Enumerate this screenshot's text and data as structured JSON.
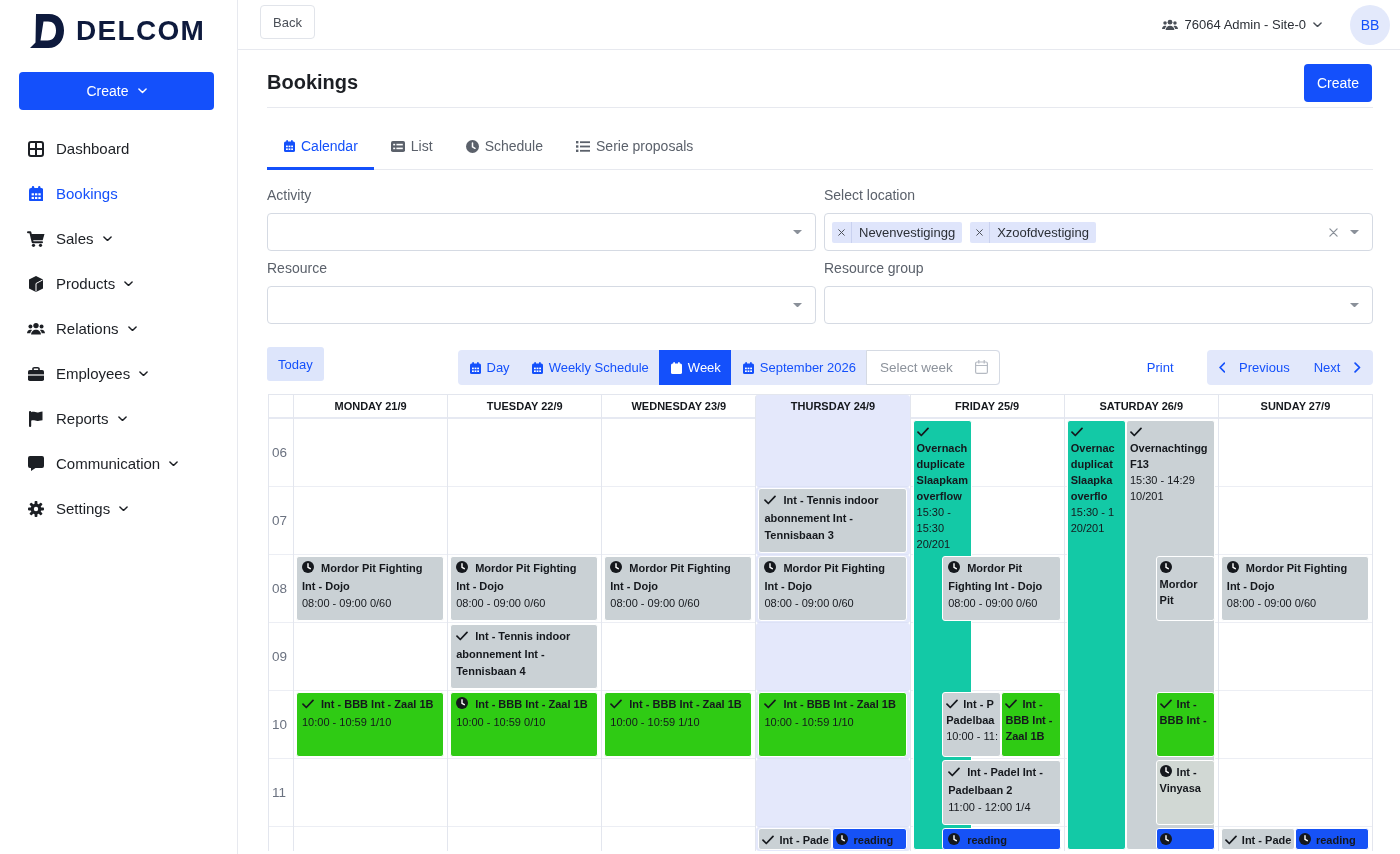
{
  "sidebar": {
    "logo": "DELCOM",
    "create_button": "Create",
    "items": [
      {
        "label": "Dashboard",
        "selected": false,
        "has_submenu": false
      },
      {
        "label": "Bookings",
        "selected": true,
        "has_submenu": false
      },
      {
        "label": "Sales",
        "selected": false,
        "has_submenu": true
      },
      {
        "label": "Products",
        "selected": false,
        "has_submenu": true
      },
      {
        "label": "Relations",
        "selected": false,
        "has_submenu": true
      },
      {
        "label": "Employees",
        "selected": false,
        "has_submenu": true
      },
      {
        "label": "Reports",
        "selected": false,
        "has_submenu": true
      },
      {
        "label": "Communication",
        "selected": false,
        "has_submenu": true
      },
      {
        "label": "Settings",
        "selected": false,
        "has_submenu": true
      }
    ]
  },
  "topbar": {
    "back_button": "Back",
    "account": "76064 Admin - Site-0",
    "avatar": "BB"
  },
  "page": {
    "title": "Bookings",
    "create_button": "Create"
  },
  "tabs": [
    {
      "label": "Calendar",
      "selected": true
    },
    {
      "label": "List",
      "selected": false
    },
    {
      "label": "Schedule",
      "selected": false
    },
    {
      "label": "Serie proposals",
      "selected": false
    }
  ],
  "filters": [
    {
      "label": "Activity"
    },
    {
      "label": "Select location",
      "tags": [
        "Nevenvestigingg",
        "Xzoofdvestiging"
      ]
    },
    {
      "label": "Resource"
    },
    {
      "label": "Resource group"
    }
  ],
  "toolbar": {
    "today_button": "Today",
    "views": [
      {
        "label": "Day",
        "selected": false
      },
      {
        "label": "Weekly Schedule",
        "selected": false
      },
      {
        "label": "Week",
        "selected": true
      },
      {
        "label": "September 2026",
        "selected": false
      }
    ],
    "week_picker": {
      "placeholder": "Select week"
    },
    "print_button": "Print",
    "previous_button": "Previous",
    "next_button": "Next"
  },
  "calendar": {
    "days": [
      {
        "label": "MONDAY 21/9",
        "today": false
      },
      {
        "label": "TUESDAY 22/9",
        "today": false
      },
      {
        "label": "WEDNESDAY 23/9",
        "today": false
      },
      {
        "label": "THURSDAY 24/9",
        "today": true
      },
      {
        "label": "FRIDAY 25/9",
        "today": false
      },
      {
        "label": "SATURDAY 26/9",
        "today": false
      },
      {
        "label": "SUNDAY 27/9",
        "today": false
      }
    ],
    "rows": [
      {
        "hour": "06",
        "cells": [
          {
            "today": false
          },
          {
            "today": false
          },
          {
            "today": false
          },
          {
            "today": true
          },
          {
            "today": false,
            "events": [
              {
                "kind": "multiday",
                "confirmed": true,
                "color": "#13c9a6",
                "title": "Overnach duplicate Slaapkam overflow",
                "time": "15:30 - 15:30 20/201"
              }
            ]
          },
          {
            "today": false,
            "events": [
              {
                "kind": "multiday",
                "confirmed": true,
                "color": "#13c9a6",
                "title": "Overnac duplicat Slaapka overflo",
                "time": "15:30 - 1 20/201"
              },
              {
                "kind": "multiday",
                "confirmed": true,
                "color": "#cad1d5",
                "title": "Overnachtingg F13",
                "time": "15:30 - 14:29 10/201"
              }
            ]
          },
          {
            "today": false
          }
        ]
      },
      {
        "hour": "07",
        "cells": [
          {
            "today": false
          },
          {
            "today": false
          },
          {
            "today": false
          },
          {
            "today": true,
            "events": [
              {
                "kind": "hourly",
                "confirmed": true,
                "color": "#cad1d5",
                "title": "Int - Tennis indoor abonnement Int - Tennisbaan 3"
              }
            ]
          },
          {
            "today": false
          },
          {
            "today": false
          },
          {
            "today": false
          }
        ]
      },
      {
        "hour": "08",
        "cells": [
          {
            "today": false,
            "events": [
              {
                "kind": "hourly",
                "confirmed": false,
                "color": "#cad1d5",
                "title": "Mordor Pit Fighting Int - Dojo",
                "time": "08:00 - 09:00 0/60"
              }
            ]
          },
          {
            "today": false,
            "events": [
              {
                "kind": "hourly",
                "confirmed": false,
                "color": "#cad1d5",
                "title": "Mordor Pit Fighting Int - Dojo",
                "time": "08:00 - 09:00 0/60"
              }
            ]
          },
          {
            "today": false,
            "events": [
              {
                "kind": "hourly",
                "confirmed": false,
                "color": "#cad1d5",
                "title": "Mordor Pit Fighting Int - Dojo",
                "time": "08:00 - 09:00 0/60"
              }
            ]
          },
          {
            "today": true,
            "events": [
              {
                "kind": "hourly",
                "confirmed": false,
                "color": "#cad1d5",
                "title": "Mordor Pit Fighting Int - Dojo",
                "time": "08:00 - 09:00 0/60"
              }
            ]
          },
          {
            "today": false,
            "events": [
              {
                "kind": "hourly",
                "confirmed": false,
                "color": "#cad1d5",
                "title": "Mordor Pit Fighting Int - Dojo",
                "time": "08:00 - 09:00 0/60"
              }
            ]
          },
          {
            "today": false,
            "events": [
              {
                "kind": "hourly",
                "confirmed": false,
                "color": "#cad1d5",
                "title": "Mordor Pit"
              }
            ]
          },
          {
            "today": false,
            "events": [
              {
                "kind": "hourly",
                "confirmed": false,
                "color": "#cad1d5",
                "title": "Mordor Pit Fighting Int - Dojo",
                "time": "08:00 - 09:00 0/60"
              }
            ]
          }
        ]
      },
      {
        "hour": "09",
        "cells": [
          {
            "today": false
          },
          {
            "today": false,
            "events": [
              {
                "kind": "hourly",
                "confirmed": true,
                "color": "#cad1d5",
                "title": "Int - Tennis indoor abonnement Int - Tennisbaan 4"
              }
            ]
          },
          {
            "today": false
          },
          {
            "today": true
          },
          {
            "today": false
          },
          {
            "today": false
          },
          {
            "today": false
          }
        ]
      },
      {
        "hour": "10",
        "cells": [
          {
            "today": false,
            "events": [
              {
                "kind": "hourly",
                "confirmed": true,
                "color": "#2fcb14",
                "title": "Int - BBB Int - Zaal 1B",
                "time": "10:00 - 10:59 1/10"
              }
            ]
          },
          {
            "today": false,
            "events": [
              {
                "kind": "hourly",
                "confirmed": false,
                "color": "#2fcb14",
                "title": "Int - BBB Int - Zaal 1B",
                "time": "10:00 - 10:59 0/10"
              }
            ]
          },
          {
            "today": false,
            "events": [
              {
                "kind": "hourly",
                "confirmed": true,
                "color": "#2fcb14",
                "title": "Int - BBB Int - Zaal 1B",
                "time": "10:00 - 10:59 1/10"
              }
            ]
          },
          {
            "today": true,
            "events": [
              {
                "kind": "hourly",
                "confirmed": true,
                "color": "#2fcb14",
                "title": "Int - BBB Int - Zaal 1B",
                "time": "10:00 - 10:59 1/10"
              }
            ]
          },
          {
            "today": false,
            "events": [
              {
                "kind": "hourly",
                "confirmed": true,
                "color": "#cad1d5",
                "title": "Int - P Padelbaa",
                "time": "10:00 - 11:"
              },
              {
                "kind": "hourly",
                "confirmed": true,
                "color": "#2fcb14",
                "title": "Int - BBB Int - Zaal 1B"
              }
            ]
          },
          {
            "today": false,
            "events": [
              {
                "kind": "hourly",
                "confirmed": true,
                "color": "#2fcb14",
                "title": "Int - BBB Int -"
              }
            ]
          },
          {
            "today": false
          }
        ]
      },
      {
        "hour": "11",
        "cells": [
          {
            "today": false
          },
          {
            "today": false
          },
          {
            "today": false
          },
          {
            "today": true
          },
          {
            "today": false,
            "events": [
              {
                "kind": "hourly",
                "confirmed": true,
                "color": "#cad1d5",
                "title": "Int - Padel Int - Padelbaan 2",
                "time": "11:00 - 12:00 1/4"
              }
            ]
          },
          {
            "today": false,
            "events": [
              {
                "kind": "hourly",
                "confirmed": false,
                "color": "#d1d8d4",
                "title": "Int - Vinyasa"
              }
            ]
          },
          {
            "today": false
          }
        ]
      },
      {
        "cells": [
          {
            "today": false
          },
          {
            "today": false
          },
          {
            "today": false
          },
          {
            "today": true,
            "events": [
              {
                "kind": "hourly",
                "confirmed": true,
                "color": "#cad1d5",
                "title": "Int - Pade"
              },
              {
                "kind": "hourly",
                "confirmed": false,
                "color": "#1652f6",
                "title": "reading"
              }
            ]
          },
          {
            "today": false,
            "events": [
              {
                "kind": "hourly",
                "confirmed": false,
                "color": "#1652f6",
                "title": "reading"
              }
            ]
          },
          {
            "today": false,
            "events": [
              {
                "kind": "hourly",
                "confirmed": false,
                "color": "#1652f6"
              }
            ]
          },
          {
            "today": false,
            "events": [
              {
                "kind": "hourly",
                "confirmed": true,
                "color": "#cad1d5",
                "title": "Int - Pade"
              },
              {
                "kind": "hourly",
                "confirmed": false,
                "color": "#1652f6",
                "title": "reading"
              }
            ]
          }
        ]
      }
    ]
  }
}
